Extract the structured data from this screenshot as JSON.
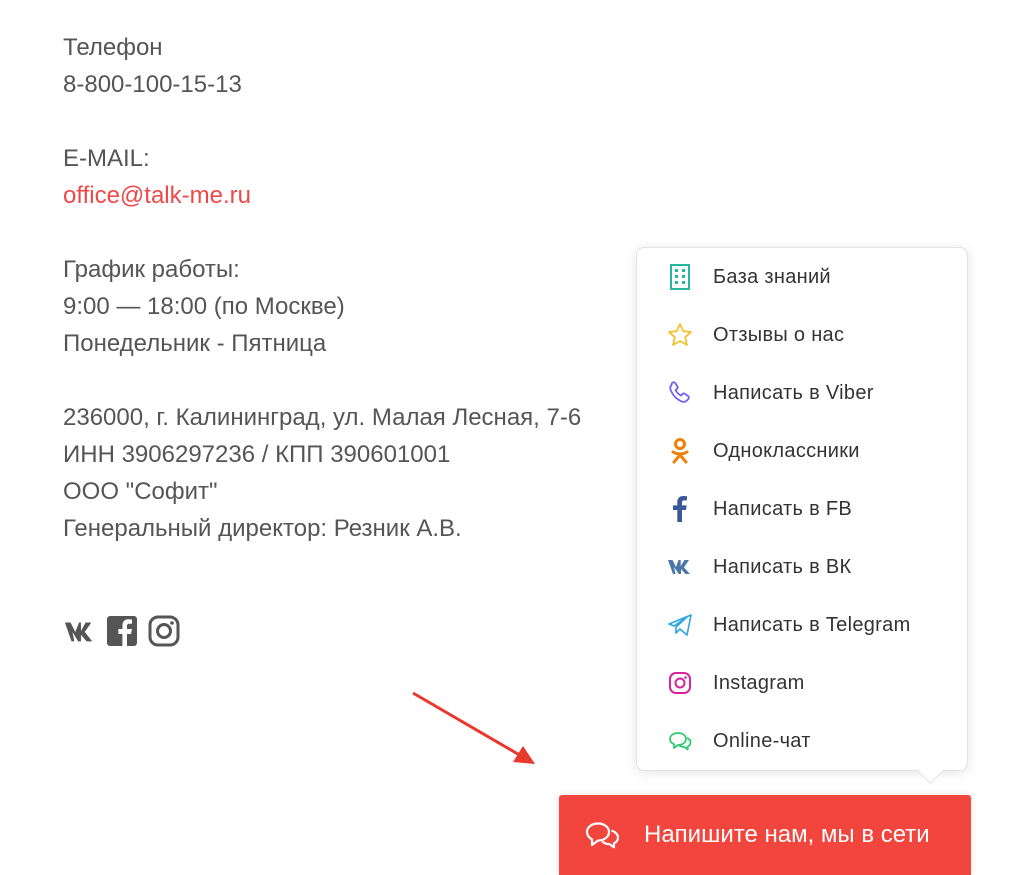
{
  "contacts": {
    "phone_label": "Телефон",
    "phone": "8-800-100-15-13",
    "email_label": "E-MAIL:",
    "email": "office@talk-me.ru",
    "schedule_label": "График работы:",
    "schedule_hours": "9:00 — 18:00 (по Москве)",
    "schedule_days": "Понедельник - Пятница",
    "address": "236000, г. Калининград, ул. Малая Лесная, 7-6",
    "inn": "ИНН 3906297236 / КПП 390601001",
    "company": "ООО \"Софит\"",
    "director": "Генеральный директор: Резник А.В."
  },
  "social_icons": [
    "vk-icon",
    "facebook-icon",
    "instagram-icon"
  ],
  "menu": {
    "items": [
      {
        "label": "База знаний",
        "icon": "building-icon",
        "color": "#2bb5a0"
      },
      {
        "label": "Отзывы о нас",
        "icon": "star-icon",
        "color": "#f2c12e"
      },
      {
        "label": "Написать в Viber",
        "icon": "viber-phone-icon",
        "color": "#7360f2"
      },
      {
        "label": "Одноклассники",
        "icon": "odnoklassniki-icon",
        "color": "#ee8208"
      },
      {
        "label": "Написать в FB",
        "icon": "facebook-icon",
        "color": "#3b5998"
      },
      {
        "label": "Написать в ВК",
        "icon": "vk-icon",
        "color": "#4a76a8"
      },
      {
        "label": "Написать в Telegram",
        "icon": "telegram-icon",
        "color": "#2ca5e0"
      },
      {
        "label": "Instagram",
        "icon": "instagram-icon",
        "color": "#d6249f"
      },
      {
        "label": "Online-чат",
        "icon": "chat-bubbles-icon",
        "color": "#2ecc71"
      }
    ]
  },
  "chat_button": {
    "label": "Напишите нам, мы в сети",
    "icon": "chat-bubbles-icon",
    "color": "#f2453d"
  },
  "accent_colors": {
    "email": "#f04848",
    "arrow": "#e8392e"
  }
}
